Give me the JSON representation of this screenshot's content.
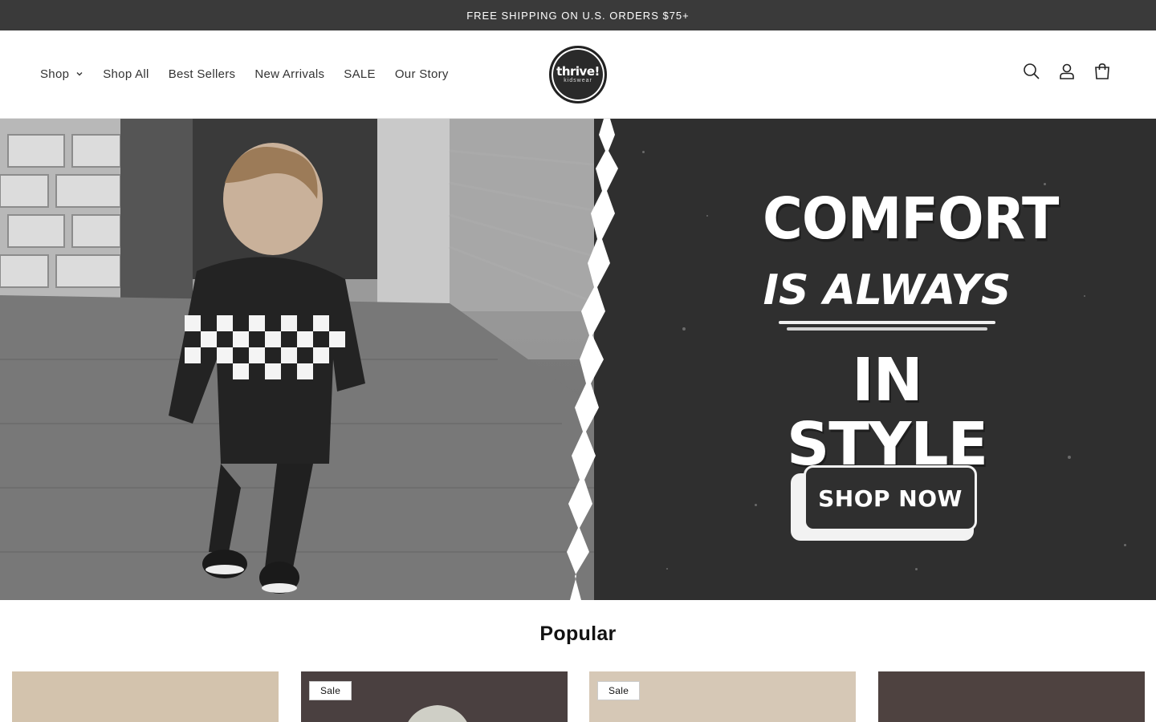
{
  "announcement": {
    "text": "FREE SHIPPING ON U.S. ORDERS $75+"
  },
  "header": {
    "nav": [
      {
        "label": "Shop",
        "has_dropdown": true
      },
      {
        "label": "Shop All"
      },
      {
        "label": "Best Sellers"
      },
      {
        "label": "New Arrivals"
      },
      {
        "label": "SALE"
      },
      {
        "label": "Our Story"
      }
    ],
    "logo": {
      "brand": "thrive!",
      "sub": "kidswear"
    },
    "icons": [
      "search-icon",
      "account-icon",
      "cart-icon"
    ]
  },
  "hero": {
    "line1": "COMFORT",
    "line2": "IS ALWAYS",
    "line3": "IN STYLE",
    "cta": "SHOP NOW",
    "colors": {
      "panel": "#2f2f2f",
      "photo": "#7b7b7b"
    }
  },
  "popular": {
    "title": "Popular",
    "products": [
      {
        "badge": "",
        "bg": "#d3c3ad"
      },
      {
        "badge": "Sale",
        "bg": "#4a4040"
      },
      {
        "badge": "Sale",
        "bg": "#d6c8b6"
      },
      {
        "badge": "",
        "bg": "#4e4240"
      }
    ]
  }
}
